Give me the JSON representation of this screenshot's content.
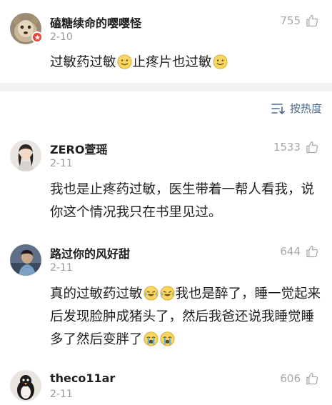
{
  "top_comment": {
    "username": "磕糖续命的嘤嘤怪",
    "date": "2-10",
    "likes": "755",
    "text_part1": "过敏药过敏",
    "text_part2": "止疼片也过敏",
    "emoji_1": "smile-emoji",
    "emoji_2": "smile-emoji"
  },
  "sort": {
    "label": "按热度",
    "icon": "sort-icon"
  },
  "comments": [
    {
      "username": "ZERO萱瑶",
      "date": "2-11",
      "likes": "1533",
      "text": "我也是止疼药过敏，医生带着一帮人看我，说你这个情况我只在书里见过。"
    },
    {
      "username": "路过你的风好甜",
      "date": "2-11",
      "likes": "644",
      "text_part1": "真的过敏药过敏",
      "text_part2": "我也是醉了，睡一觉起来后发现脸肿成猪头了，然后我爸还说我睡觉睡多了然后变胖了",
      "emojis_a": [
        "laugh-cry-emoji",
        "laugh-cry-emoji"
      ],
      "emojis_b": [
        "crying-emoji",
        "crying-emoji"
      ]
    },
    {
      "username": "theco11ar",
      "date": "2-11",
      "likes": "606"
    }
  ],
  "colors": {
    "username": "#1f1f1f",
    "meta": "#9a9a9a",
    "sort_label": "#4a6a8c",
    "divider": "#f2f2f2",
    "badge": "#e8413a"
  }
}
